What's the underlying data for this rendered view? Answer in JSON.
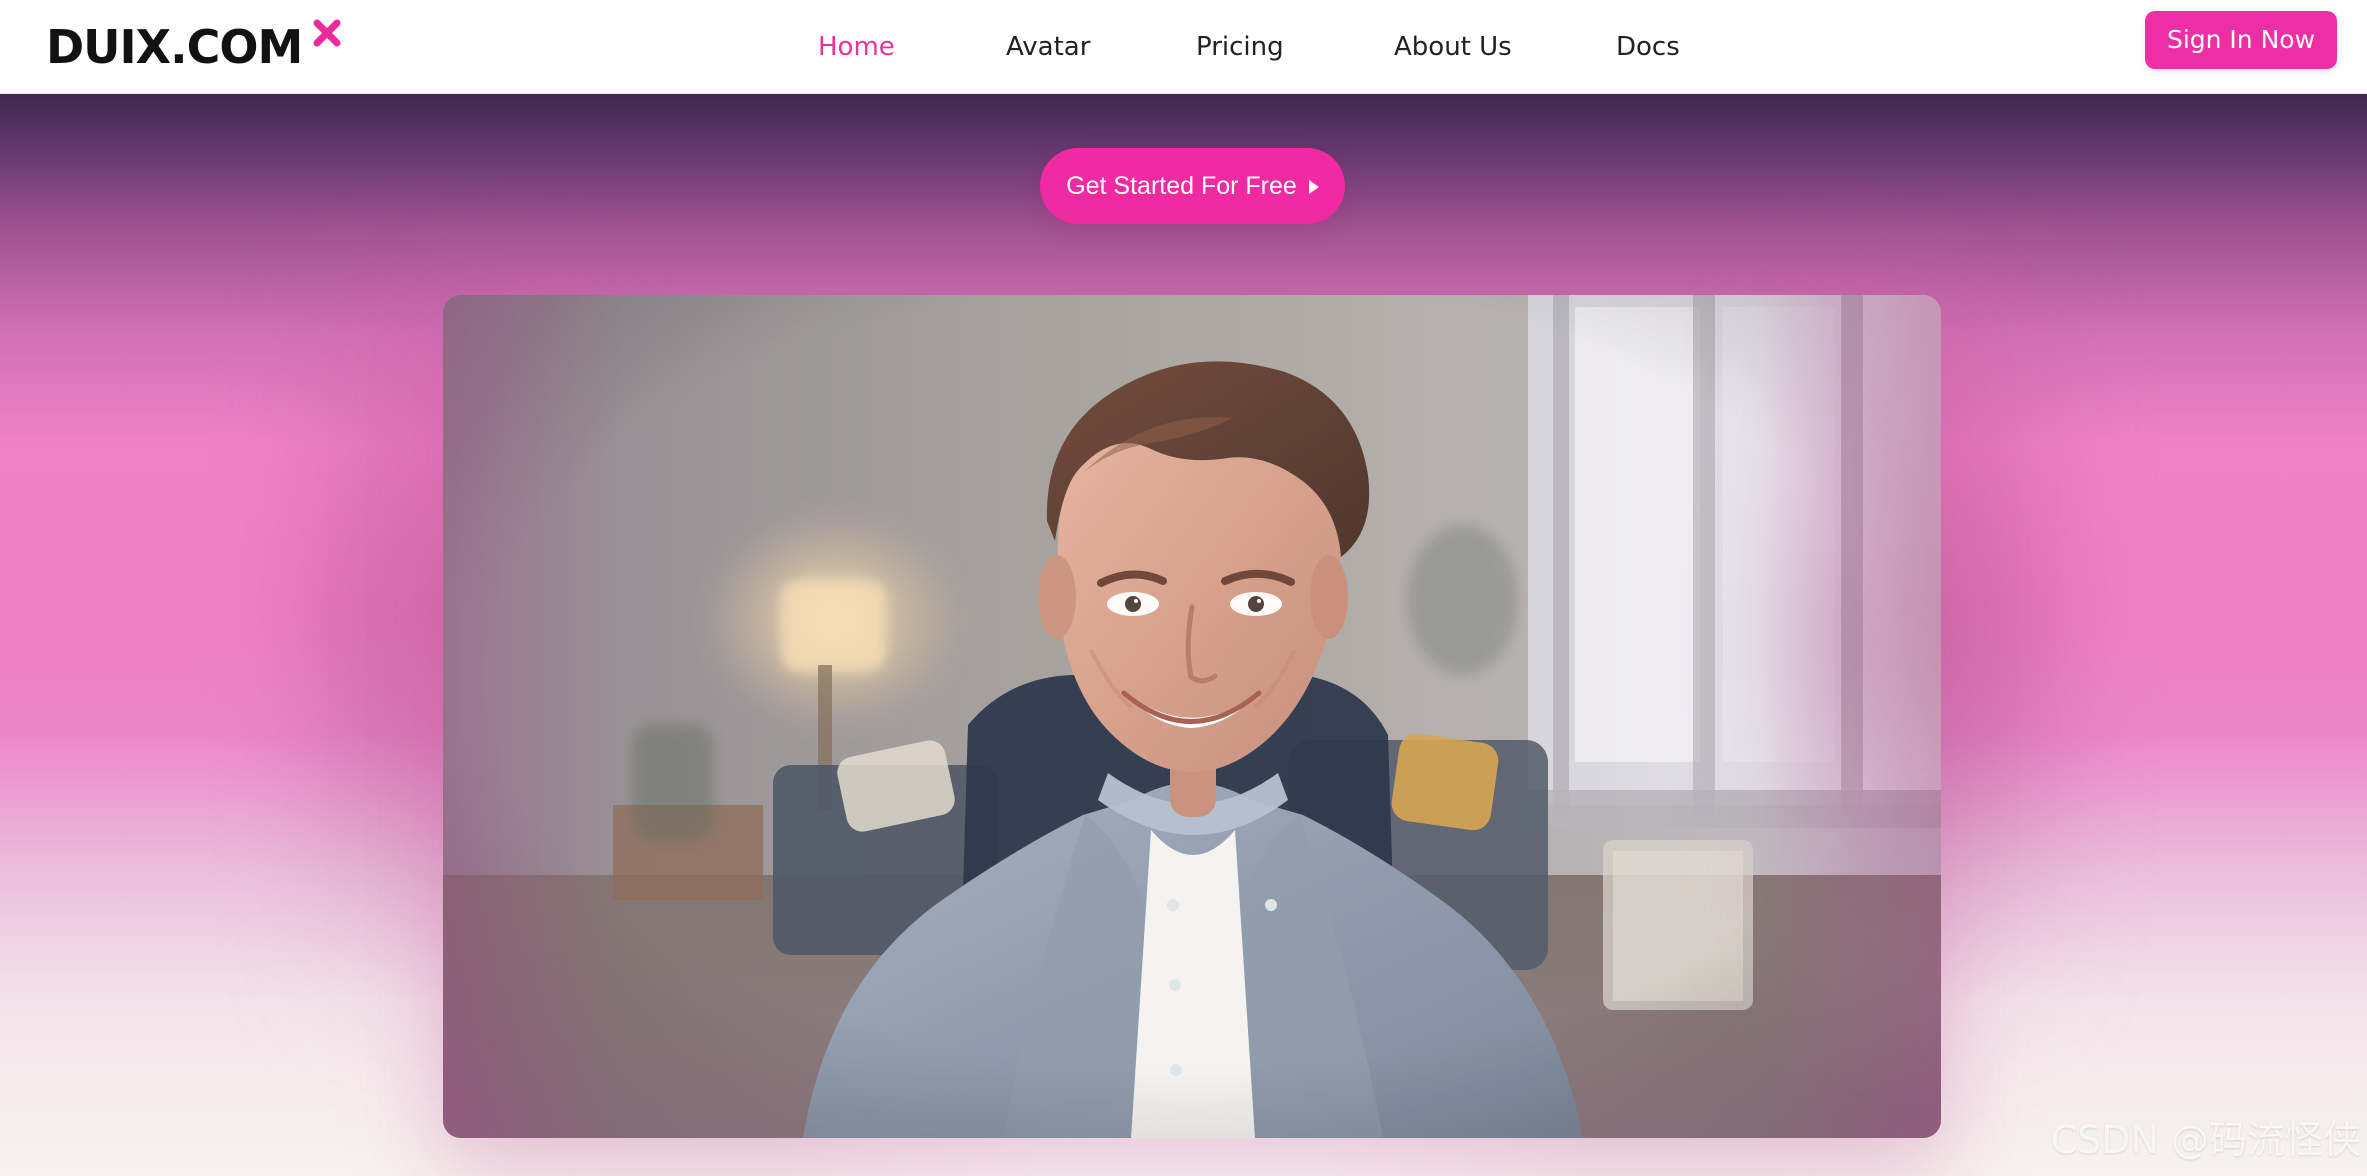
{
  "header": {
    "brand": "DUIX.COM",
    "nav": [
      {
        "label": "Home",
        "active": true
      },
      {
        "label": "Avatar",
        "active": false
      },
      {
        "label": "Pricing",
        "active": false
      },
      {
        "label": "About Us",
        "active": false
      },
      {
        "label": "Docs",
        "active": false
      }
    ],
    "signin_label": "Sign In Now"
  },
  "hero": {
    "cta_label": "Get Started For Free",
    "media_icon": "avatar-preview-image"
  },
  "overlay": {
    "watermark": "CSDN @码流怪侠"
  },
  "colors": {
    "accent": "#ee2ea5",
    "nav_active": "#e7339a",
    "header_bg": "#ffffff",
    "hero_top": "#40284f",
    "hero_mid": "#ef82c8",
    "hero_bottom": "#f7f2ef"
  },
  "icons": {
    "brand_mark": "x-mark-icon",
    "cta_arrow": "play-triangle-icon"
  }
}
